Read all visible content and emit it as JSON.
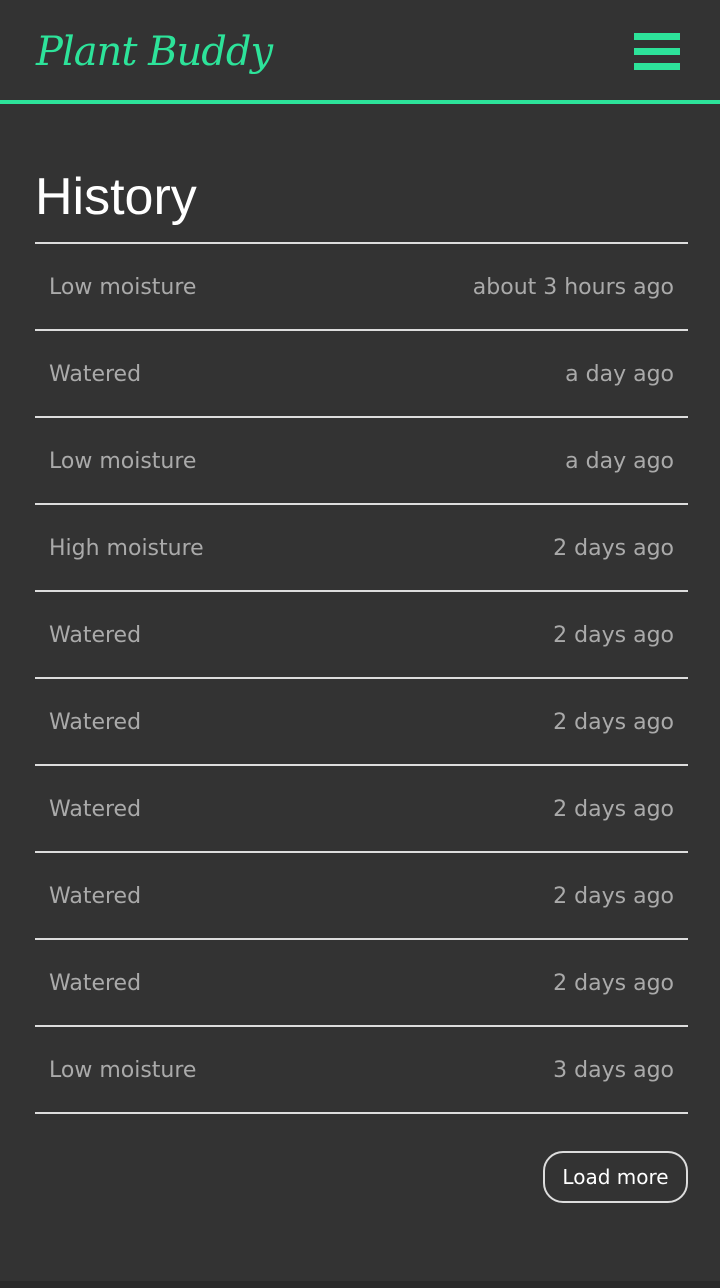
{
  "app": {
    "name": "Plant Buddy",
    "accent_color": "#2de39a",
    "background_color": "#333333"
  },
  "header": {
    "logo_text": "Plant Buddy",
    "menu_icon": "hamburger-menu-icon"
  },
  "page": {
    "title": "History"
  },
  "history": [
    {
      "event": "Low moisture",
      "time": "about 3 hours ago"
    },
    {
      "event": "Watered",
      "time": "a day ago"
    },
    {
      "event": "Low moisture",
      "time": "a day ago"
    },
    {
      "event": "High moisture",
      "time": "2 days ago"
    },
    {
      "event": "Watered",
      "time": "2 days ago"
    },
    {
      "event": "Watered",
      "time": "2 days ago"
    },
    {
      "event": "Watered",
      "time": "2 days ago"
    },
    {
      "event": "Watered",
      "time": "2 days ago"
    },
    {
      "event": "Watered",
      "time": "2 days ago"
    },
    {
      "event": "Low moisture",
      "time": "3 days ago"
    }
  ],
  "actions": {
    "load_more_label": "Load more"
  }
}
